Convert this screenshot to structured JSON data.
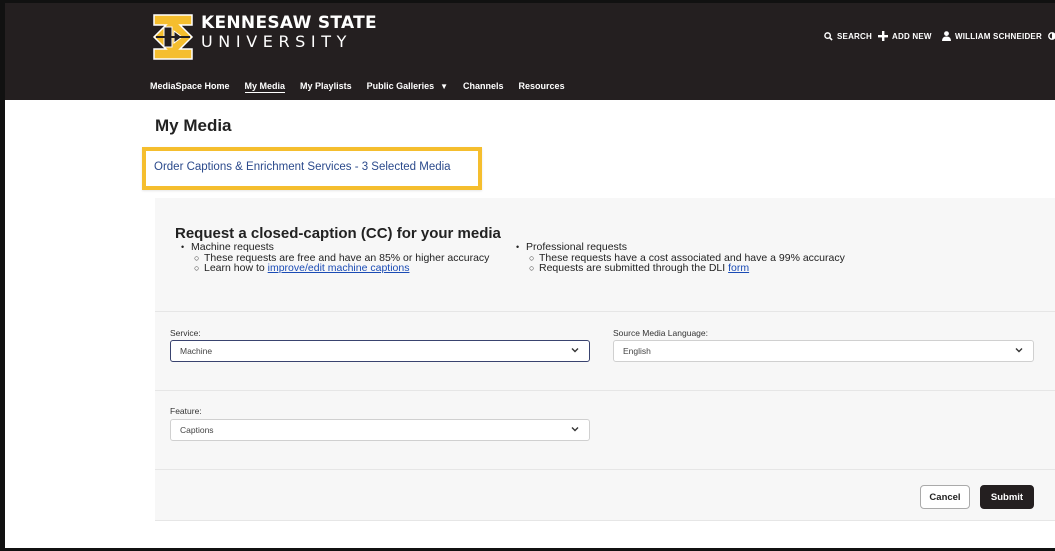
{
  "header": {
    "brand_line1": "KENNESAW STATE",
    "brand_line2": "UNIVERSITY",
    "search_label": "SEARCH",
    "add_new_label": "ADD NEW",
    "user_label": "WILLIAM SCHNEIDER",
    "nav": [
      "MediaSpace Home",
      "My Media",
      "My Playlists",
      "Public Galleries",
      "Channels",
      "Resources"
    ]
  },
  "page": {
    "title": "My Media",
    "order_link": "Order Captions & Enrichment Services - 3 Selected Media"
  },
  "info": {
    "title": "Request a closed-caption (CC) for your media",
    "machine": {
      "heading": "Machine requests",
      "line1": "These requests are free and have an 85% or higher accuracy",
      "line2_prefix": "Learn how to ",
      "line2_link": "improve/edit machine captions"
    },
    "professional": {
      "heading": "Professional requests",
      "line1": "These requests have a cost associated and have a 99% accuracy",
      "line2_prefix": "Requests are submitted through the DLI ",
      "line2_link": "form"
    }
  },
  "form": {
    "service_label": "Service:",
    "service_value": "Machine",
    "language_label": "Source Media Language:",
    "language_value": "English",
    "feature_label": "Feature:",
    "feature_value": "Captions",
    "cancel_label": "Cancel",
    "submit_label": "Submit"
  },
  "colors": {
    "header_bg": "#241f20",
    "ksu_gold": "#f5be2e",
    "link_blue": "#1a4bb5",
    "focus_border": "#39436f"
  }
}
